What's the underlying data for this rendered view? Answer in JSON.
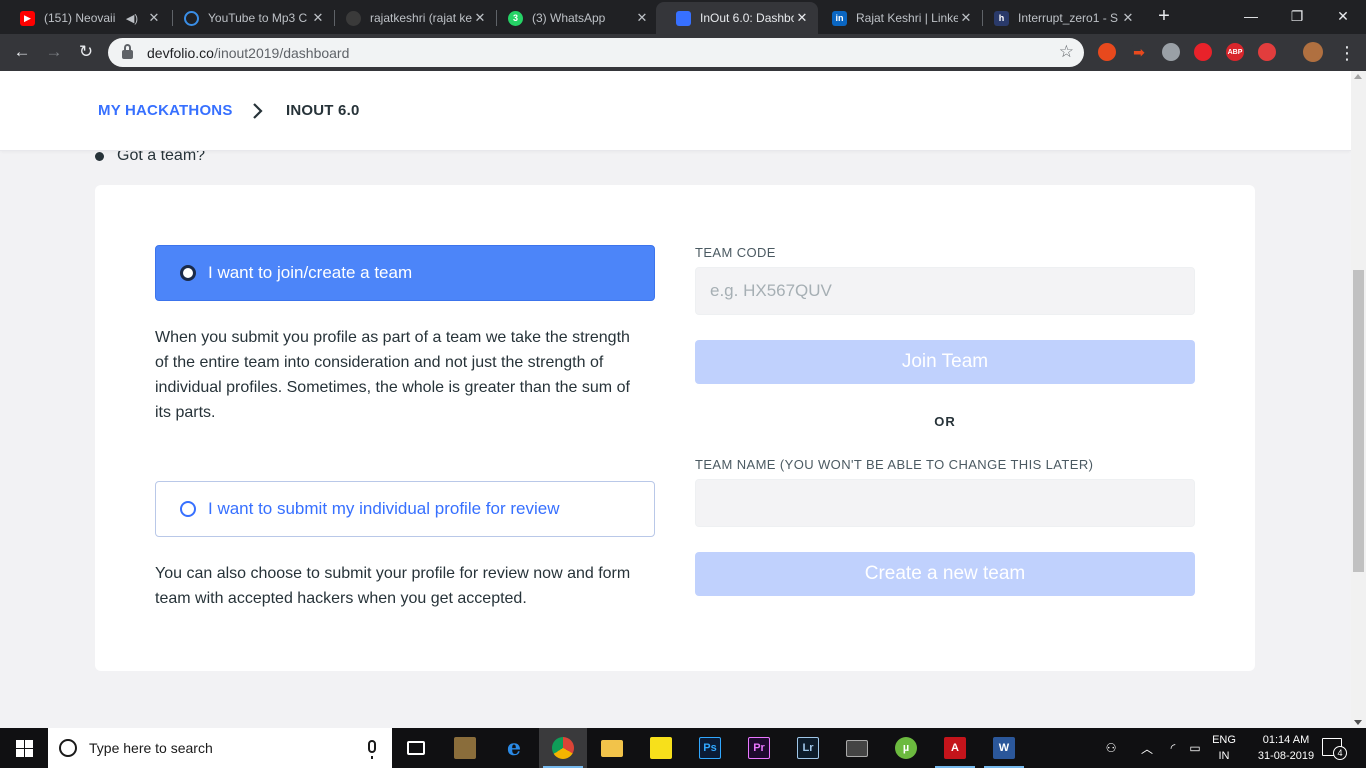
{
  "browser": {
    "tabs": [
      {
        "title": "(151) Neovaii",
        "favicon": "youtube-icon",
        "color": "#ff0000",
        "audio": true,
        "active": false
      },
      {
        "title": "YouTube to Mp3 C",
        "favicon": "cloud-download-icon",
        "color": "#3a8ee6",
        "active": false
      },
      {
        "title": "rajatkeshri (rajat ke",
        "favicon": "github-icon",
        "color": "#3a3a3a",
        "active": false
      },
      {
        "title": "(3) WhatsApp",
        "favicon": "whatsapp-icon",
        "color": "#25d366",
        "badge": "3",
        "active": false
      },
      {
        "title": "InOut 6.0: Dashboa",
        "favicon": "devfolio-icon",
        "color": "#3770ff",
        "active": true
      },
      {
        "title": "Rajat Keshri | Linke",
        "favicon": "linkedin-icon",
        "color": "#0a66c2",
        "active": false
      },
      {
        "title": "Interrupt_zero1 - S",
        "favicon": "hackerrank-icon",
        "color": "#2a3a6a",
        "active": false
      }
    ],
    "new_tab": "+",
    "url_host": "devfolio.co",
    "url_path": "/inout2019/dashboard"
  },
  "breadcrumb": {
    "parent": "MY HACKATHONS",
    "current": "INOUT 6.0"
  },
  "section_heading": "Got a team?",
  "team_options": {
    "join": {
      "label": "I want to join/create a team",
      "description": "When you submit you profile as part of a team we take the strength of the entire team into consideration and not just the strength of individual profiles. Sometimes, the whole is greater than the sum of its parts.",
      "selected": true
    },
    "individual": {
      "label": "I want to submit my individual profile for review",
      "description": "You can also choose to submit your profile for review now and form team with accepted hackers when you get accepted.",
      "selected": false
    }
  },
  "team_form": {
    "code_label": "TEAM CODE",
    "code_placeholder": "e.g. HX567QUV",
    "code_value": "",
    "join_button": "Join Team",
    "or_text": "OR",
    "name_label": "TEAM NAME (YOU WON'T BE ABLE TO CHANGE THIS LATER)",
    "name_placeholder": "",
    "name_value": "",
    "create_button": "Create a new team"
  },
  "taskbar": {
    "search_placeholder": "Type here to search",
    "language": "ENG",
    "region": "IN",
    "time": "01:14 AM",
    "date": "31-08-2019",
    "notifications": "4"
  },
  "colors": {
    "brand_blue": "#3770ff",
    "selected_option": "#4c85f9",
    "disabled_button": "#c0d1fd",
    "text_dark": "#273339"
  }
}
